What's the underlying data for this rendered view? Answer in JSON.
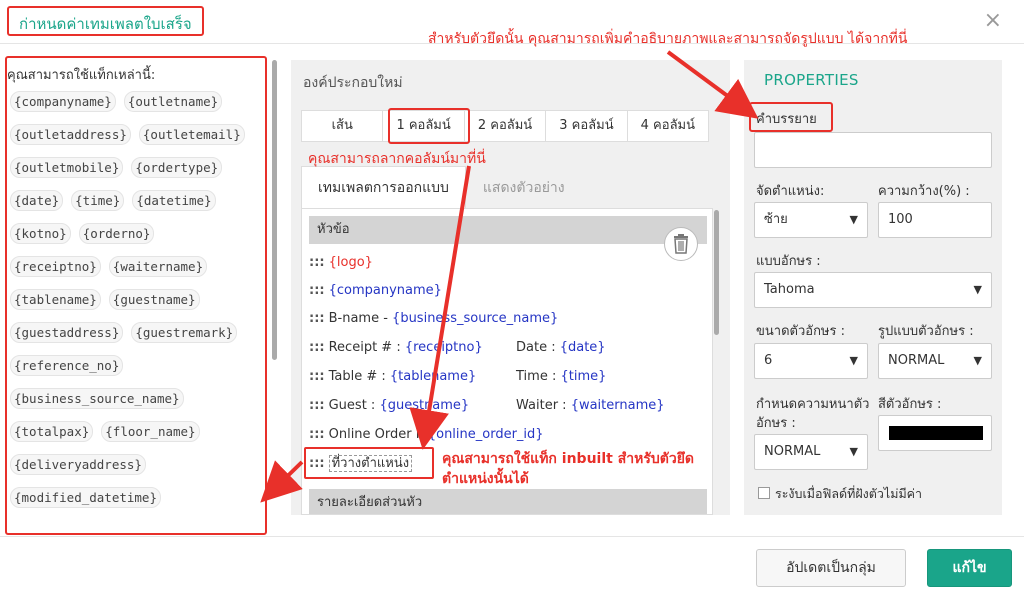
{
  "modal": {
    "title": "ก่าหนดค่าเทมเพลตใบเสร็จ",
    "close_glyph": "×"
  },
  "annotations": {
    "top": "สำหรับตัวยึดนั้น คุณสามารถเพิ่มคำอธิบายภาพและสามารถจัดรูปแบบ ได้จากที่นี่",
    "drag": "คุณสามารถลากคอลัมน์มาที่นี่",
    "inbuilt_line1": "คุณสามารถใช้แท็ก inbuilt สำหรับตัวยึด",
    "inbuilt_line2": "ตำแหน่งนั้นได้"
  },
  "tags_panel": {
    "title": "คุณสามารถใช้แท็กเหล่านี้:",
    "tags": [
      "{companyname}",
      "{outletname}",
      "{outletaddress}",
      "{outletemail}",
      "{outletmobile}",
      "{ordertype}",
      "{date}",
      "{time}",
      "{datetime}",
      "{kotno}",
      "{orderno}",
      "{receiptno}",
      "{waitername}",
      "{tablename}",
      "{guestname}",
      "{guestaddress}",
      "{guestremark}",
      "{reference_no}",
      "{business_source_name}",
      "{totalpax}",
      "{floor_name}",
      "{deliveryaddress}",
      "{modified_datetime}"
    ]
  },
  "components": {
    "title": "องค์ประกอบใหม่",
    "column_tabs": [
      "เส้น",
      "1 คอลัมน์",
      "2 คอลัมน์",
      "3 คอลัมน์",
      "4 คอลัมน์"
    ],
    "view_tabs": [
      "เทมเพลตการออกแบบ",
      "แสดงตัวอย่าง"
    ]
  },
  "template": {
    "header_section": "หัวข้อ",
    "handle": ":::",
    "rows": {
      "logo": "{logo}",
      "companyname": "{companyname}",
      "bname_label": "B-name - ",
      "bname_tag": "{business_source_name}",
      "receipt_label": "Receipt # : ",
      "receipt_tag": "{receiptno}",
      "date_label": "Date : ",
      "date_tag": "{date}",
      "table_label": "Table # : ",
      "table_tag": "{tablename}",
      "time_label": "Time : ",
      "time_tag": "{time}",
      "guest_label": "Guest : ",
      "guest_tag": "{guestname}",
      "waiter_label": "Waiter : ",
      "waiter_tag": "{waitername}",
      "online_label": "Online Order Id",
      "online_tag": "{online_order_id}",
      "placeholder": "ที่วางตำแหน่ง"
    },
    "detail_section": "รายละเอียดส่วนหัว"
  },
  "properties": {
    "title": "PROPERTIES",
    "description_label": "คำบรรยาย",
    "description_value": "",
    "align_label": "จัดตำแหน่ง:",
    "align_value": "ซ้าย",
    "width_label": "ความกว้าง(%) :",
    "width_value": "100",
    "font_label": "แบบอักษร :",
    "font_value": "Tahoma",
    "size_label": "ขนาดตัวอักษร :",
    "size_value": "6",
    "style_label": "รูปแบบตัวอักษร :",
    "style_value": "NORMAL",
    "weight_label_1": "กำหนดความหนาตัว",
    "weight_label_2": "อักษร :",
    "weight_value": "NORMAL",
    "color_label": "สีตัวอักษร :",
    "color_value": "#000000",
    "caret": "▼",
    "suppress_label": "ระงับเมื่อฟิลด์ที่ฝังตัวไม่มีค่า"
  },
  "footer": {
    "update_group": "อัปเดตเป็นกลุ่ม",
    "edit": "แก้ไข"
  },
  "colors": {
    "accent": "#1aa58a",
    "annotation": "#e8302a",
    "tag_text": "#2535c4"
  }
}
